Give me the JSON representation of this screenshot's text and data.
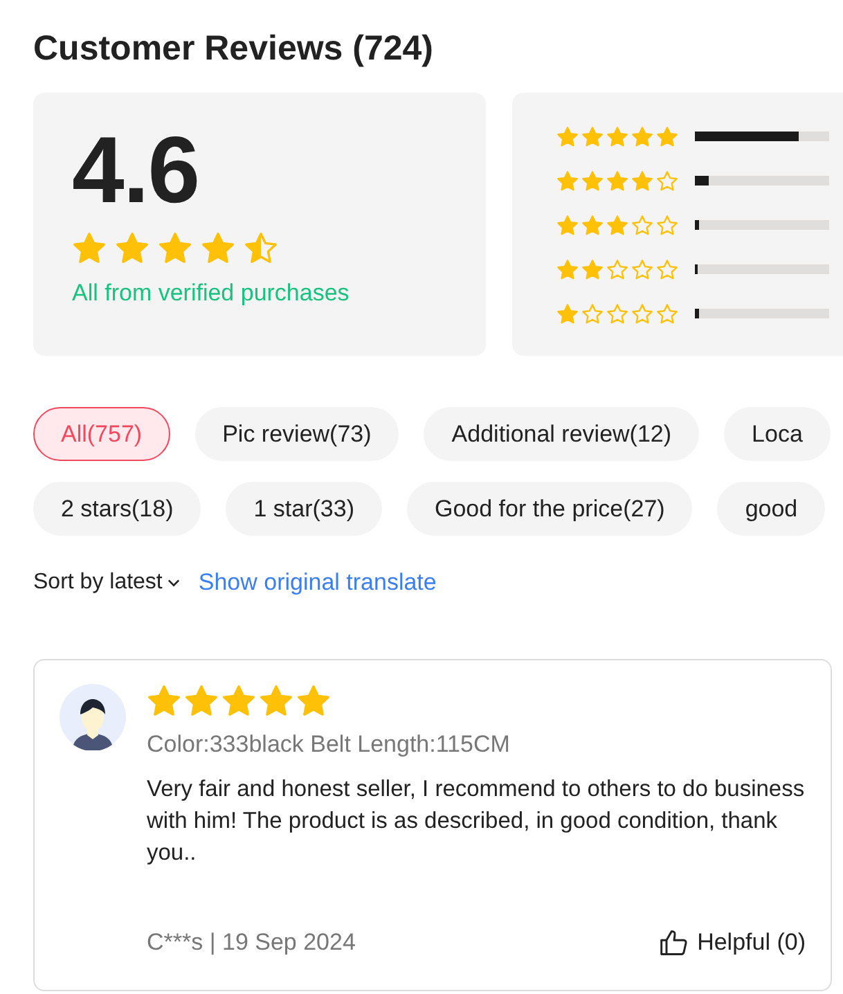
{
  "title": "Customer Reviews (724)",
  "summary": {
    "score": "4.6",
    "stars": 4.5,
    "note": "All from verified purchases"
  },
  "distribution": [
    {
      "stars": 5,
      "level": 0.77
    },
    {
      "stars": 4,
      "level": 0.1
    },
    {
      "stars": 3,
      "level": 0.03
    },
    {
      "stars": 2,
      "level": 0.02
    },
    {
      "stars": 1,
      "level": 0.03
    }
  ],
  "filter_rows": [
    {
      "chips": [
        {
          "label": "All(757)",
          "selected": true
        },
        {
          "label": "Pic review(73)",
          "selected": false
        },
        {
          "label": "Additional review(12)",
          "selected": false
        },
        {
          "label": "Loca",
          "selected": false
        }
      ]
    },
    {
      "chips": [
        {
          "label": "2 stars(18)",
          "selected": false
        },
        {
          "label": "1 star(33)",
          "selected": false
        },
        {
          "label": "Good for the price(27)",
          "selected": false
        },
        {
          "label": "good",
          "selected": false
        }
      ]
    }
  ],
  "sort": {
    "label": "Sort by latest"
  },
  "translate_link": "Show original translate",
  "reviews": [
    {
      "stars": 5,
      "variant": "Color:333black Belt Length:115CM",
      "text": "Very fair and honest seller, I recommend to others to do business with him! The product is as described, in good condition, thank you..",
      "byline": "C***s | 19 Sep 2024",
      "helpful": "Helpful (0)"
    }
  ]
}
